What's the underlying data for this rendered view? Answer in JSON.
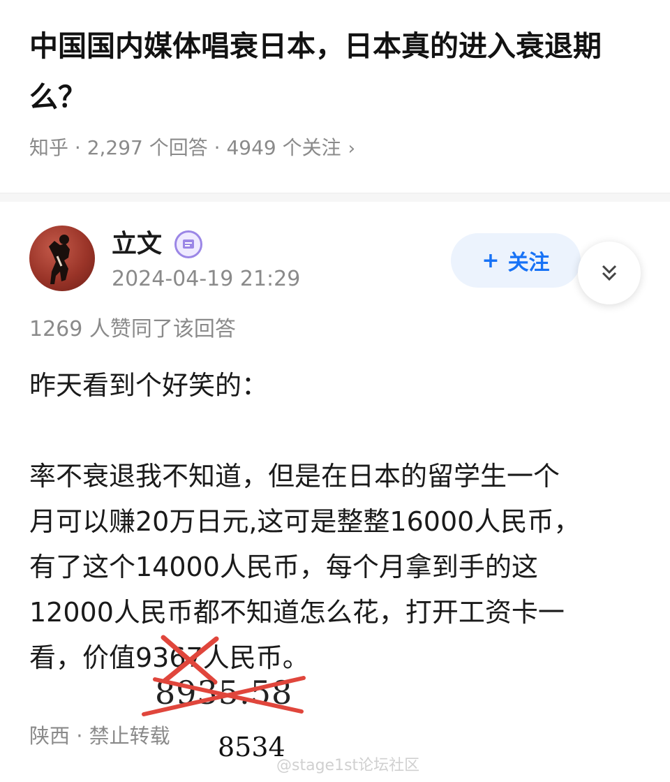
{
  "question": {
    "title": "中国国内媒体唱衰日本，日本真的进入衰退期么？",
    "meta": "知乎 · 2,297 个回答 · 4949 个关注",
    "chevron": "›"
  },
  "answer": {
    "author": "立文",
    "timestamp": "2024-04-19 21:29",
    "follow_plus": "+",
    "follow_label": "关注",
    "votes": "1269 人赞同了该回答",
    "paragraphs": [
      "昨天看到个好笑的：",
      "率不衰退我不知道，但是在日本的留学生一个",
      "月可以赚20万日元,这可是整整16000人民币，",
      "有了这个14000人民币，每个月拿到手的这",
      "12000人民币都不知道怎么花，打开工资卡一",
      "看，价值9367人民币。"
    ],
    "location": "陕西 · 禁止转载"
  },
  "annotations": {
    "handwritten_1": "8935.58",
    "handwritten_2": "8534",
    "cross_color": "#e0463c"
  },
  "watermark": "@stage1st论坛社区",
  "icons": {
    "badge": "verified-badge-icon",
    "collapse": "double-chevron-down-icon",
    "avatar": "avatar-silhouette"
  }
}
